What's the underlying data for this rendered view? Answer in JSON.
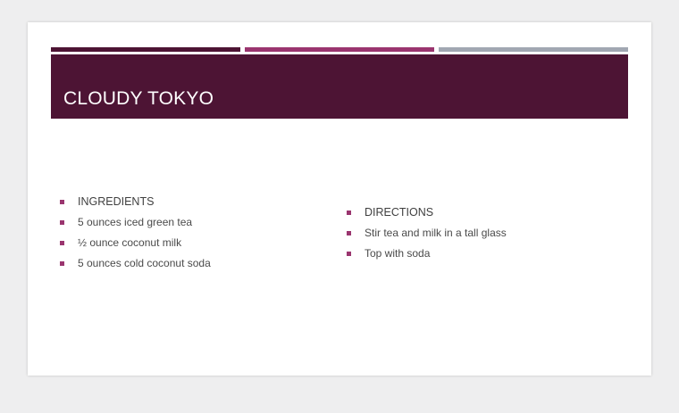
{
  "theme": {
    "title_band_color": "#4d1434",
    "accent_colors": [
      "#4d1434",
      "#9a356f",
      "#a1a7b2"
    ],
    "bullet_color": "#9a356f"
  },
  "slide": {
    "title": "CLOUDY TOKYO",
    "left_column": {
      "heading": "INGREDIENTS",
      "items": [
        "5 ounces iced green tea",
        "½ ounce coconut milk",
        "5 ounces cold coconut soda"
      ]
    },
    "right_column": {
      "heading": "DIRECTIONS",
      "items": [
        "Stir tea and milk in a tall glass",
        "Top with soda"
      ]
    }
  }
}
